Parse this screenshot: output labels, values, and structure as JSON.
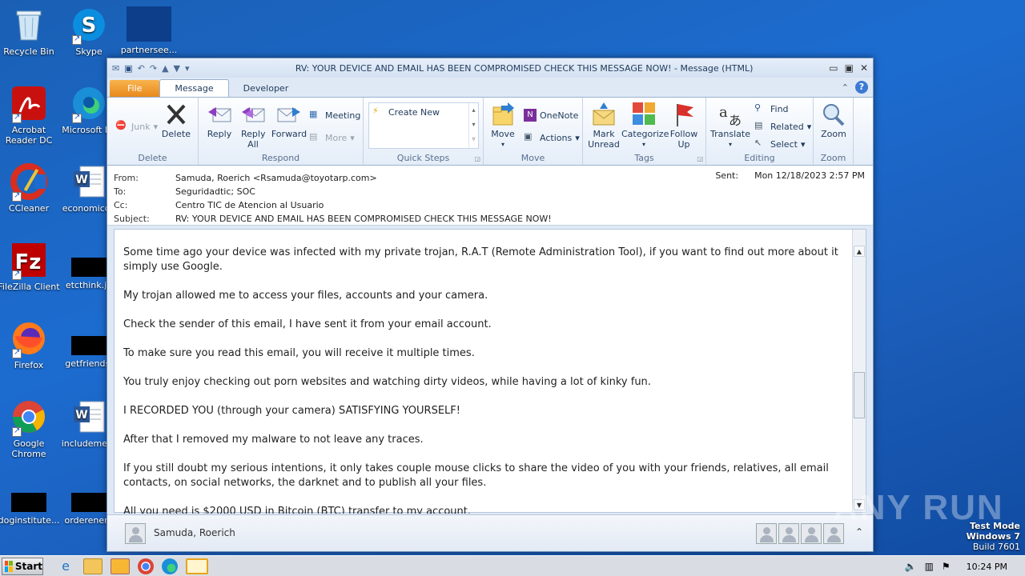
{
  "desktop": {
    "icons": [
      {
        "label": "Recycle Bin"
      },
      {
        "label": "Skype"
      },
      {
        "label": "partnersee..."
      },
      {
        "label": "Acrobat Reader DC"
      },
      {
        "label": "Microsoft Ed"
      },
      {
        "label": "CCleaner"
      },
      {
        "label": "economicdv"
      },
      {
        "label": "FileZilla Client"
      },
      {
        "label": "etcthink.jp"
      },
      {
        "label": "Firefox"
      },
      {
        "label": "getfriends."
      },
      {
        "label": "Google Chrome"
      },
      {
        "label": "includemeth"
      },
      {
        "label": "doginstitute..."
      },
      {
        "label": "orderenerg"
      }
    ]
  },
  "window": {
    "title": "RV: YOUR DEVICE AND EMAIL HAS BEEN COMPROMISED CHECK THIS MESSAGE NOW! - Message (HTML)",
    "tabs": [
      "File",
      "Message",
      "Developer"
    ],
    "ribbon": {
      "delete_group": {
        "label": "Delete",
        "junk": "Junk",
        "delete": "Delete"
      },
      "respond_group": {
        "label": "Respond",
        "reply": "Reply",
        "reply_all": "Reply All",
        "forward": "Forward",
        "meeting": "Meeting",
        "more": "More"
      },
      "quicksteps_group": {
        "label": "Quick Steps",
        "create_new": "Create New"
      },
      "move_group": {
        "label": "Move",
        "move": "Move",
        "onenote": "OneNote",
        "actions": "Actions"
      },
      "tags_group": {
        "label": "Tags",
        "mark_unread": "Mark Unread",
        "categorize": "Categorize",
        "follow_up": "Follow Up"
      },
      "editing_group": {
        "label": "Editing",
        "translate": "Translate",
        "find": "Find",
        "related": "Related",
        "select": "Select"
      },
      "zoom_group": {
        "label": "Zoom",
        "zoom": "Zoom"
      }
    },
    "header": {
      "from_label": "From:",
      "from_value": "Samuda, Roerich <Rsamuda@toyotarp.com>",
      "to_label": "To:",
      "to_value": "Seguridadtic; SOC",
      "cc_label": "Cc:",
      "cc_value": "Centro TIC de Atencion al Usuario",
      "subject_label": "Subject:",
      "subject_value": "RV: YOUR DEVICE AND EMAIL HAS BEEN COMPROMISED CHECK THIS MESSAGE NOW!",
      "sent_label": "Sent:",
      "sent_value": "Mon 12/18/2023 2:57 PM"
    },
    "body": {
      "paragraphs": [
        "Some time ago your device was infected with my private trojan, R.A.T (Remote Administration Tool), if you want to find out more about it simply use Google.",
        "My trojan allowed me to access your files, accounts and your camera.",
        "Check the sender of this email, I have sent it from your email account.",
        "To make sure you read this email, you will receive it multiple times.",
        "You truly enjoy checking out porn websites and watching dirty videos, while having a lot of kinky fun.",
        "I RECORDED YOU (through your camera) SATISFYING YOURSELF!",
        "After that I removed my malware to not leave any traces.",
        "If you still doubt my serious intentions, it only takes couple mouse clicks to share the video of you with your friends, relatives, all email contacts, on social networks, the darknet and to publish all your files.",
        "All you need is $2000 USD in Bitcoin (BTC) transfer to my account."
      ]
    },
    "people_pane": {
      "name": "Samuda, Roerich"
    }
  },
  "taskbar": {
    "start": "Start",
    "clock": "10:24 PM"
  },
  "watermark": {
    "line1": "Test Mode",
    "line2": "Windows 7",
    "line3": "Build 7601",
    "brand": "ANY RUN"
  }
}
